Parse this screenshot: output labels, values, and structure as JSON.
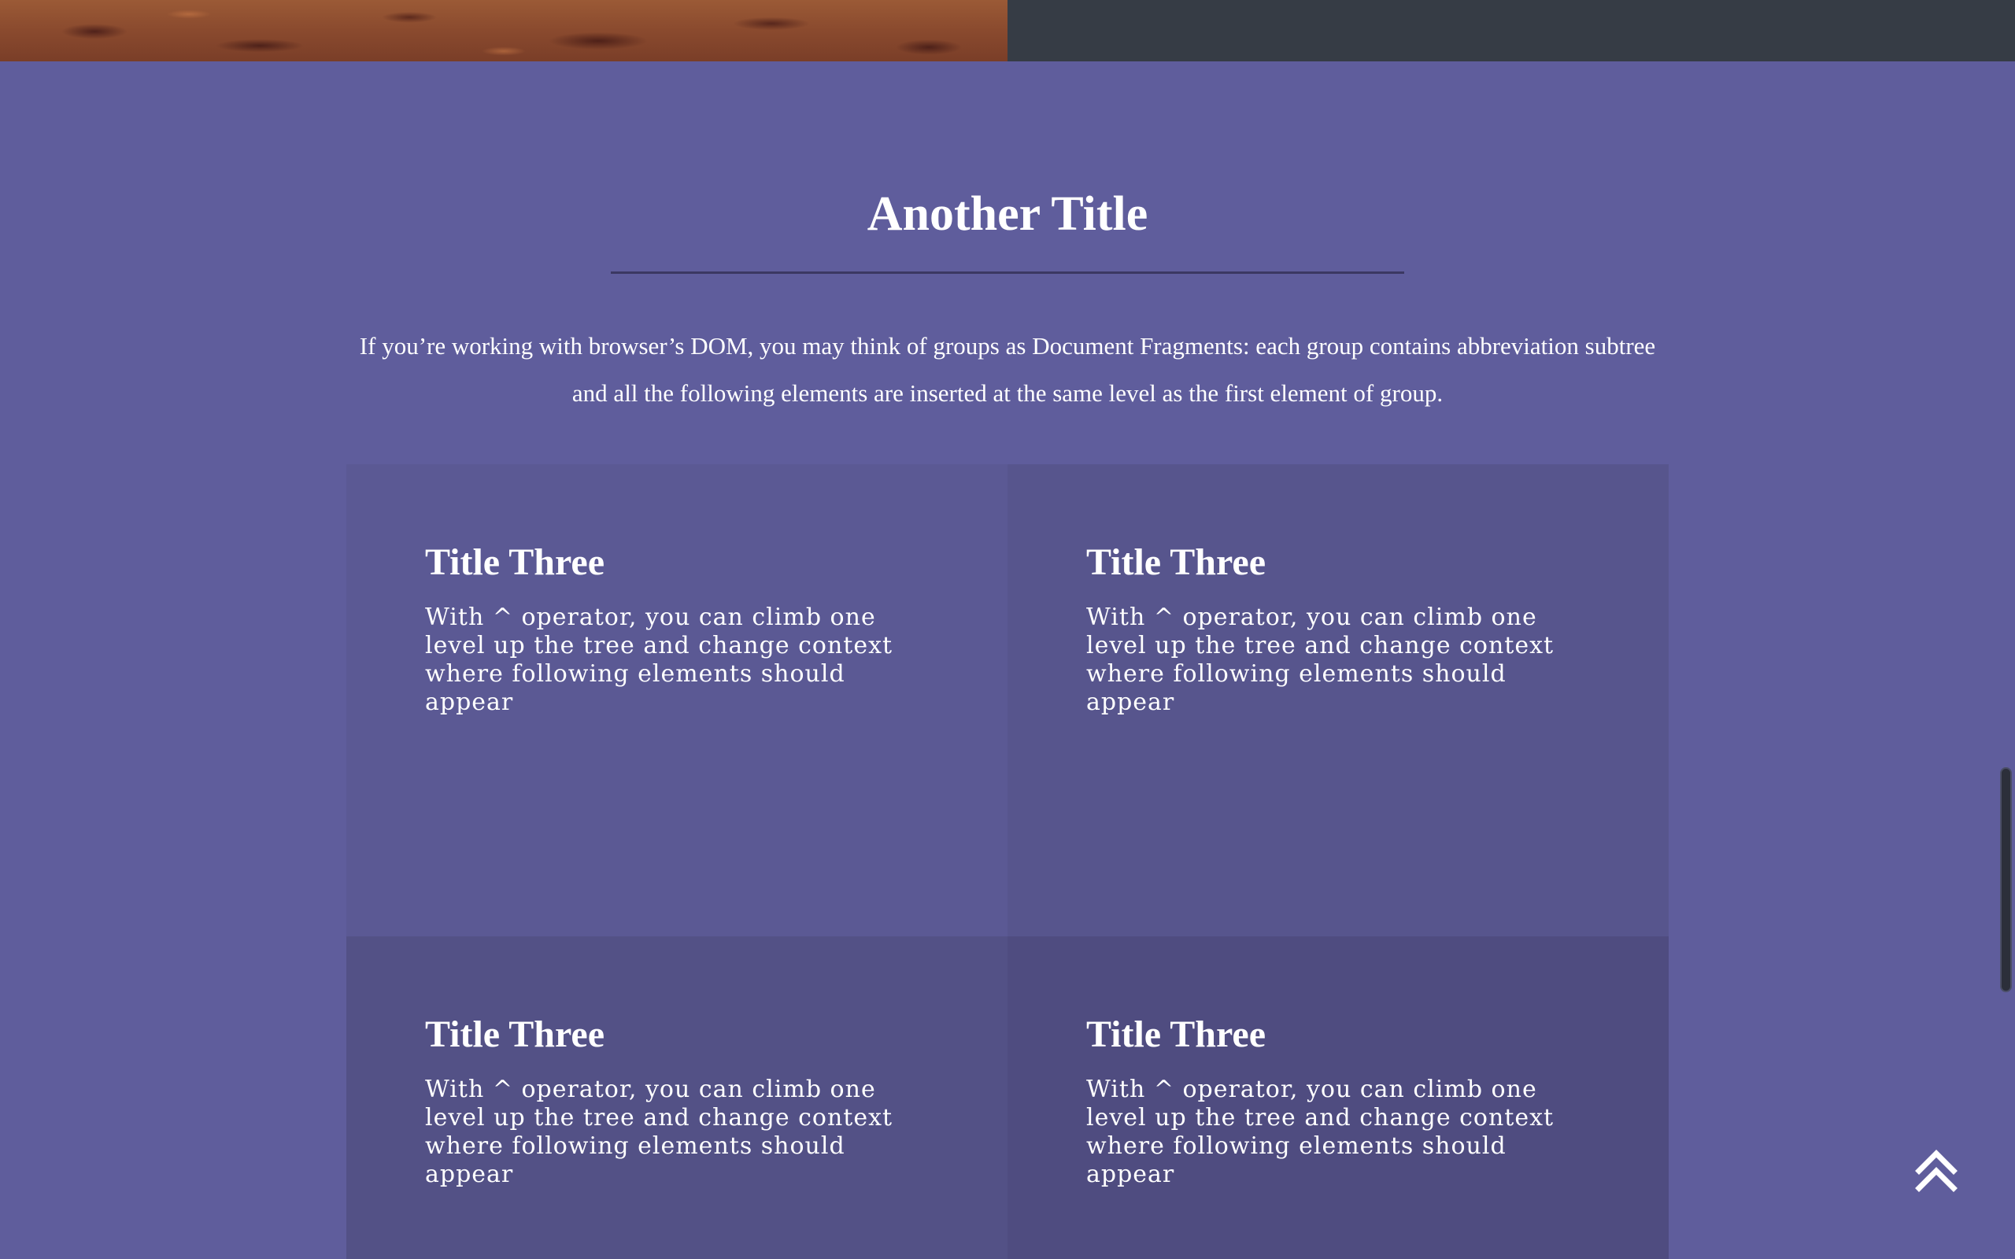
{
  "section": {
    "title": "Another Title",
    "intro": "If you’re working with browser’s DOM, you may think of groups as Document Fragments: each group contains abbreviation subtree and all the following elements are inserted at the same level as the first element of group."
  },
  "cards": [
    {
      "title": "Title Three",
      "text": "With ^ operator, you can climb one level up the tree and change context where following elements should appear"
    },
    {
      "title": "Title Three",
      "text": "With ^ operator, you can climb one level up the tree and change context where following elements should appear"
    },
    {
      "title": "Title Three",
      "text": "With ^ operator, you can climb one level up the tree and change context where following elements should appear"
    },
    {
      "title": "Title Three",
      "text": "With ^ operator, you can climb one level up the tree and change context where following elements should appear"
    }
  ],
  "icons": {
    "back_to_top": "double-chevron-up-icon"
  },
  "colors": {
    "background": "#5f5d9c",
    "header_dark": "#363c45",
    "rule": "#3b3862",
    "text": "#ffffff"
  }
}
